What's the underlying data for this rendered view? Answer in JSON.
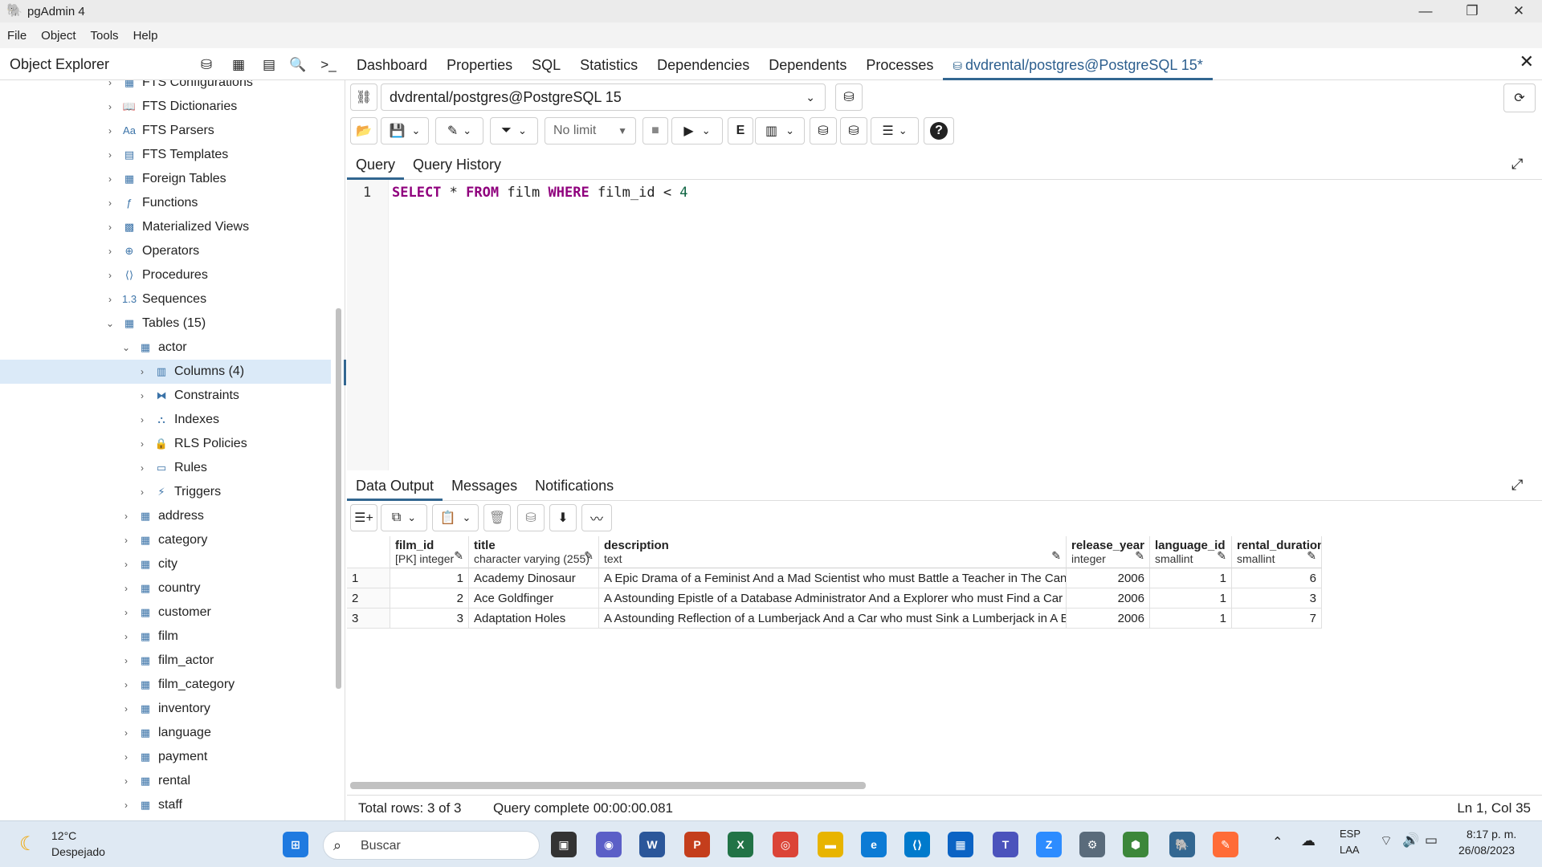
{
  "window": {
    "title": "pgAdmin 4",
    "minimize": "—",
    "maximize": "❐",
    "close": "✕"
  },
  "menu": [
    "File",
    "Object",
    "Tools",
    "Help"
  ],
  "object_explorer": {
    "title": "Object Explorer",
    "tree": [
      {
        "label": "FTS Configurations",
        "icon": "fts-config-icon",
        "glyph": "▦"
      },
      {
        "label": "FTS Dictionaries",
        "icon": "fts-dictionary-icon",
        "glyph": "📖"
      },
      {
        "label": "FTS Parsers",
        "icon": "fts-parser-icon",
        "glyph": "Aa"
      },
      {
        "label": "FTS Templates",
        "icon": "fts-template-icon",
        "glyph": "▤"
      },
      {
        "label": "Foreign Tables",
        "icon": "foreign-table-icon",
        "glyph": "▦"
      },
      {
        "label": "Functions",
        "icon": "function-icon",
        "glyph": "ƒ"
      },
      {
        "label": "Materialized Views",
        "icon": "materialized-view-icon",
        "glyph": "▩"
      },
      {
        "label": "Operators",
        "icon": "operator-icon",
        "glyph": "⊕"
      },
      {
        "label": "Procedures",
        "icon": "procedure-icon",
        "glyph": "⟨⟩"
      },
      {
        "label": "Sequences",
        "icon": "sequence-icon",
        "glyph": "1.3"
      },
      {
        "label": "Tables (15)",
        "icon": "tables-icon",
        "glyph": "▦"
      },
      {
        "label": "actor",
        "icon": "table-icon",
        "glyph": "▦"
      },
      {
        "label": "Columns (4)",
        "icon": "columns-icon",
        "glyph": "▥"
      },
      {
        "label": "Constraints",
        "icon": "constraint-icon",
        "glyph": "⧓"
      },
      {
        "label": "Indexes",
        "icon": "index-icon",
        "glyph": "⛬"
      },
      {
        "label": "RLS Policies",
        "icon": "rls-policy-icon",
        "glyph": "🔒"
      },
      {
        "label": "Rules",
        "icon": "rule-icon",
        "glyph": "▭"
      },
      {
        "label": "Triggers",
        "icon": "trigger-icon",
        "glyph": "⚡"
      },
      {
        "label": "address",
        "icon": "table-icon",
        "glyph": "▦"
      },
      {
        "label": "category",
        "icon": "table-icon",
        "glyph": "▦"
      },
      {
        "label": "city",
        "icon": "table-icon",
        "glyph": "▦"
      },
      {
        "label": "country",
        "icon": "table-icon",
        "glyph": "▦"
      },
      {
        "label": "customer",
        "icon": "table-icon",
        "glyph": "▦"
      },
      {
        "label": "film",
        "icon": "table-icon",
        "glyph": "▦"
      },
      {
        "label": "film_actor",
        "icon": "table-icon",
        "glyph": "▦"
      },
      {
        "label": "film_category",
        "icon": "table-icon",
        "glyph": "▦"
      },
      {
        "label": "inventory",
        "icon": "table-icon",
        "glyph": "▦"
      },
      {
        "label": "language",
        "icon": "table-icon",
        "glyph": "▦"
      },
      {
        "label": "payment",
        "icon": "table-icon",
        "glyph": "▦"
      },
      {
        "label": "rental",
        "icon": "table-icon",
        "glyph": "▦"
      },
      {
        "label": "staff",
        "icon": "table-icon",
        "glyph": "▦"
      }
    ]
  },
  "main_tabs": [
    "Dashboard",
    "Properties",
    "SQL",
    "Statistics",
    "Dependencies",
    "Dependents",
    "Processes",
    "dvdrental/postgres@PostgreSQL 15*"
  ],
  "connection": "dvdrental/postgres@PostgreSQL 15",
  "toolbar": {
    "limit": "No limit"
  },
  "query_tabs": [
    "Query",
    "Query History"
  ],
  "editor": {
    "line": "1",
    "tokens": [
      {
        "t": "SELECT",
        "k": "kw"
      },
      {
        "t": " * ",
        "k": ""
      },
      {
        "t": "FROM",
        "k": "kw"
      },
      {
        "t": " film ",
        "k": ""
      },
      {
        "t": "WHERE",
        "k": "kw"
      },
      {
        "t": " film_id < ",
        "k": ""
      },
      {
        "t": "4",
        "k": "num"
      }
    ]
  },
  "result_tabs": [
    "Data Output",
    "Messages",
    "Notifications"
  ],
  "grid": {
    "columns": [
      {
        "name": "film_id",
        "type": "[PK] integer"
      },
      {
        "name": "title",
        "type": "character varying (255)"
      },
      {
        "name": "description",
        "type": "text"
      },
      {
        "name": "release_year",
        "type": "integer"
      },
      {
        "name": "language_id",
        "type": "smallint"
      },
      {
        "name": "rental_duration",
        "type": "smallint"
      }
    ],
    "rows": [
      [
        "1",
        "1",
        "Academy Dinosaur",
        "A Epic Drama of a Feminist And a Mad Scientist who must Battle a Teacher in The Canadian Rockies",
        "2006",
        "1",
        "6"
      ],
      [
        "2",
        "2",
        "Ace Goldfinger",
        "A Astounding Epistle of a Database Administrator And a Explorer who must Find a Car in Ancient Ch...",
        "2006",
        "1",
        "3"
      ],
      [
        "3",
        "3",
        "Adaptation Holes",
        "A Astounding Reflection of a Lumberjack And a Car who must Sink a Lumberjack in A Baloon Factory",
        "2006",
        "1",
        "7"
      ]
    ]
  },
  "status": {
    "rows": "Total rows: 3 of 3",
    "query": "Query complete 00:00:00.081",
    "position": "Ln 1, Col 35"
  },
  "taskbar": {
    "weather_temp": "12°C",
    "weather_desc": "Despejado",
    "search": "Buscar",
    "lang1": "ESP",
    "lang2": "LAA",
    "time": "8:17 p. m.",
    "date": "26/08/2023",
    "apps": [
      {
        "name": "start-icon",
        "color": "#1f7ae0",
        "glyph": "⊞"
      },
      {
        "name": "task-view-icon",
        "color": "#333333",
        "glyph": "▣"
      },
      {
        "name": "teams-chat-icon",
        "color": "#5b5fc7",
        "glyph": "◉"
      },
      {
        "name": "word-icon",
        "color": "#2b579a",
        "glyph": "W"
      },
      {
        "name": "powerpoint-icon",
        "color": "#c43e1c",
        "glyph": "P"
      },
      {
        "name": "excel-icon",
        "color": "#217346",
        "glyph": "X"
      },
      {
        "name": "chrome-icon",
        "color": "#db4437",
        "glyph": "◎"
      },
      {
        "name": "file-explorer-icon",
        "color": "#e8b400",
        "glyph": "▬"
      },
      {
        "name": "edge-icon",
        "color": "#0c7bd5",
        "glyph": "e"
      },
      {
        "name": "vscode-icon",
        "color": "#007acc",
        "glyph": "⟨⟩"
      },
      {
        "name": "store-icon",
        "color": "#0b63c4",
        "glyph": "▦"
      },
      {
        "name": "teams-icon",
        "color": "#4b53bc",
        "glyph": "T"
      },
      {
        "name": "zoom-icon",
        "color": "#2d8cff",
        "glyph": "Z"
      },
      {
        "name": "settings-icon",
        "color": "#5a6b7b",
        "glyph": "⚙"
      },
      {
        "name": "node-icon",
        "color": "#3c873a",
        "glyph": "⬢"
      },
      {
        "name": "pgadmin-icon",
        "color": "#336791",
        "glyph": "🐘"
      },
      {
        "name": "postman-icon",
        "color": "#ff6c37",
        "glyph": "✎"
      }
    ]
  }
}
